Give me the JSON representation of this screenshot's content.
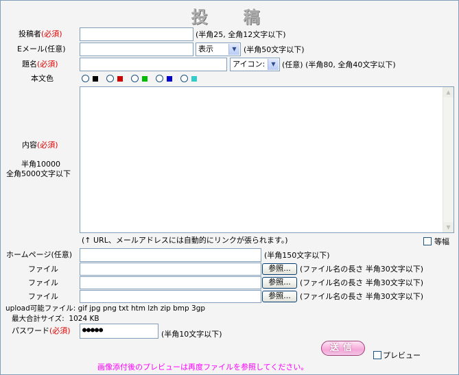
{
  "title": "投　稿",
  "name": {
    "label": "投稿者",
    "required": "(必須)",
    "value": "",
    "hint": "(半角25, 全角12文字以下)"
  },
  "email": {
    "label": "Eメール(任意)",
    "value": "",
    "display_option": "表示",
    "hint": "(半角50文字以下)"
  },
  "subject": {
    "label": "題名",
    "required": "(必須)",
    "value": "",
    "icon_option": "アイコン:",
    "hint": "(任意) (半角80, 全角40文字以下)"
  },
  "text_color": {
    "label": "本文色",
    "colors": [
      "#000000",
      "#cc0000",
      "#00bb00",
      "#0000cc",
      "#33cccc"
    ]
  },
  "content": {
    "label": "内容",
    "required": "(必須)",
    "limit_line1": "半角10000",
    "limit_line2": "全角5000文字以下",
    "value": "",
    "note": "(↑ URL、メールアドレスには自動的にリンクが張られます。)",
    "monospace_label": "等幅"
  },
  "homepage": {
    "label": "ホームページ(任意)",
    "value": "",
    "hint": "(半角150文字以下)"
  },
  "files": [
    {
      "label": "ファイル",
      "button": "参照...",
      "hint": "(ファイル名の長さ 半角30文字以下)"
    },
    {
      "label": "ファイル",
      "button": "参照...",
      "hint": "(ファイル名の長さ 半角30文字以下)"
    },
    {
      "label": "ファイル",
      "button": "参照...",
      "hint": "(ファイル名の長さ 半角30文字以下)"
    }
  ],
  "upload_types": "upload可能ファイル: gif jpg png txt htm lzh zip bmp 3gp",
  "max_total_size": "最大合計サイズ:  1024 KB",
  "password": {
    "label": "パスワード",
    "required": "(必須)",
    "value": "●●●●●",
    "hint": "(半角10文字以下)"
  },
  "submit_label": "送信",
  "preview_label": "プレビュー",
  "preview_note": "画像添付後のプレビューは再度ファイルを参照してください。"
}
